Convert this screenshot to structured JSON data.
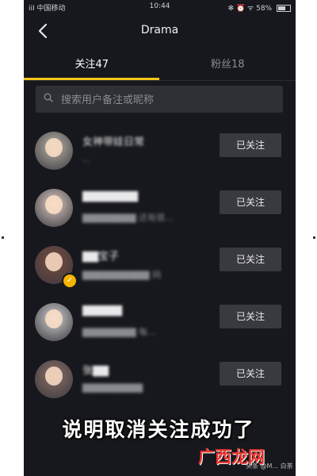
{
  "status_bar": {
    "left": "iiI 中国移动",
    "time": "10:44",
    "right": "✻ ⏰ ᯤ 58%"
  },
  "header": {
    "back_icon": "back-chevron-icon",
    "title": "Drama"
  },
  "tabs": [
    {
      "label": "关注47",
      "active": true
    },
    {
      "label": "粉丝18",
      "active": false
    }
  ],
  "search": {
    "placeholder": "搜索用户备注或昵称",
    "icon": "search-icon"
  },
  "follow_list": [
    {
      "name": "女神带娃日常",
      "desc": "...",
      "button": "已关注",
      "avatar_color": "#b9b2a6"
    },
    {
      "name": "▇▇▇▇▇▇▇",
      "desc": "▇▇▇▇▇▇▇▇ 还有很...",
      "button": "已关注",
      "avatar_color": "#d9c9c0"
    },
    {
      "name": "▇▇宝子",
      "desc": "▇▇▇▇▇▇▇▇▇▇ 网",
      "button": "已关注",
      "avatar_color": "#7a4a3d",
      "badge": true
    },
    {
      "name": "▇▇▇▇▇",
      "desc": "▇▇▇▇▇▇▇▇ 每...",
      "button": "已关注",
      "avatar_color": "#cfcfcf"
    },
    {
      "name": "张▇▇",
      "desc": "▇▇▇▇▇▇▇▇▇",
      "button": "已关注",
      "avatar_color": "#8a6e66"
    }
  ],
  "caption": "说明取消关注成功了",
  "watermark": {
    "brand": "广西龙网",
    "source": "头条 @M... 白茶"
  }
}
